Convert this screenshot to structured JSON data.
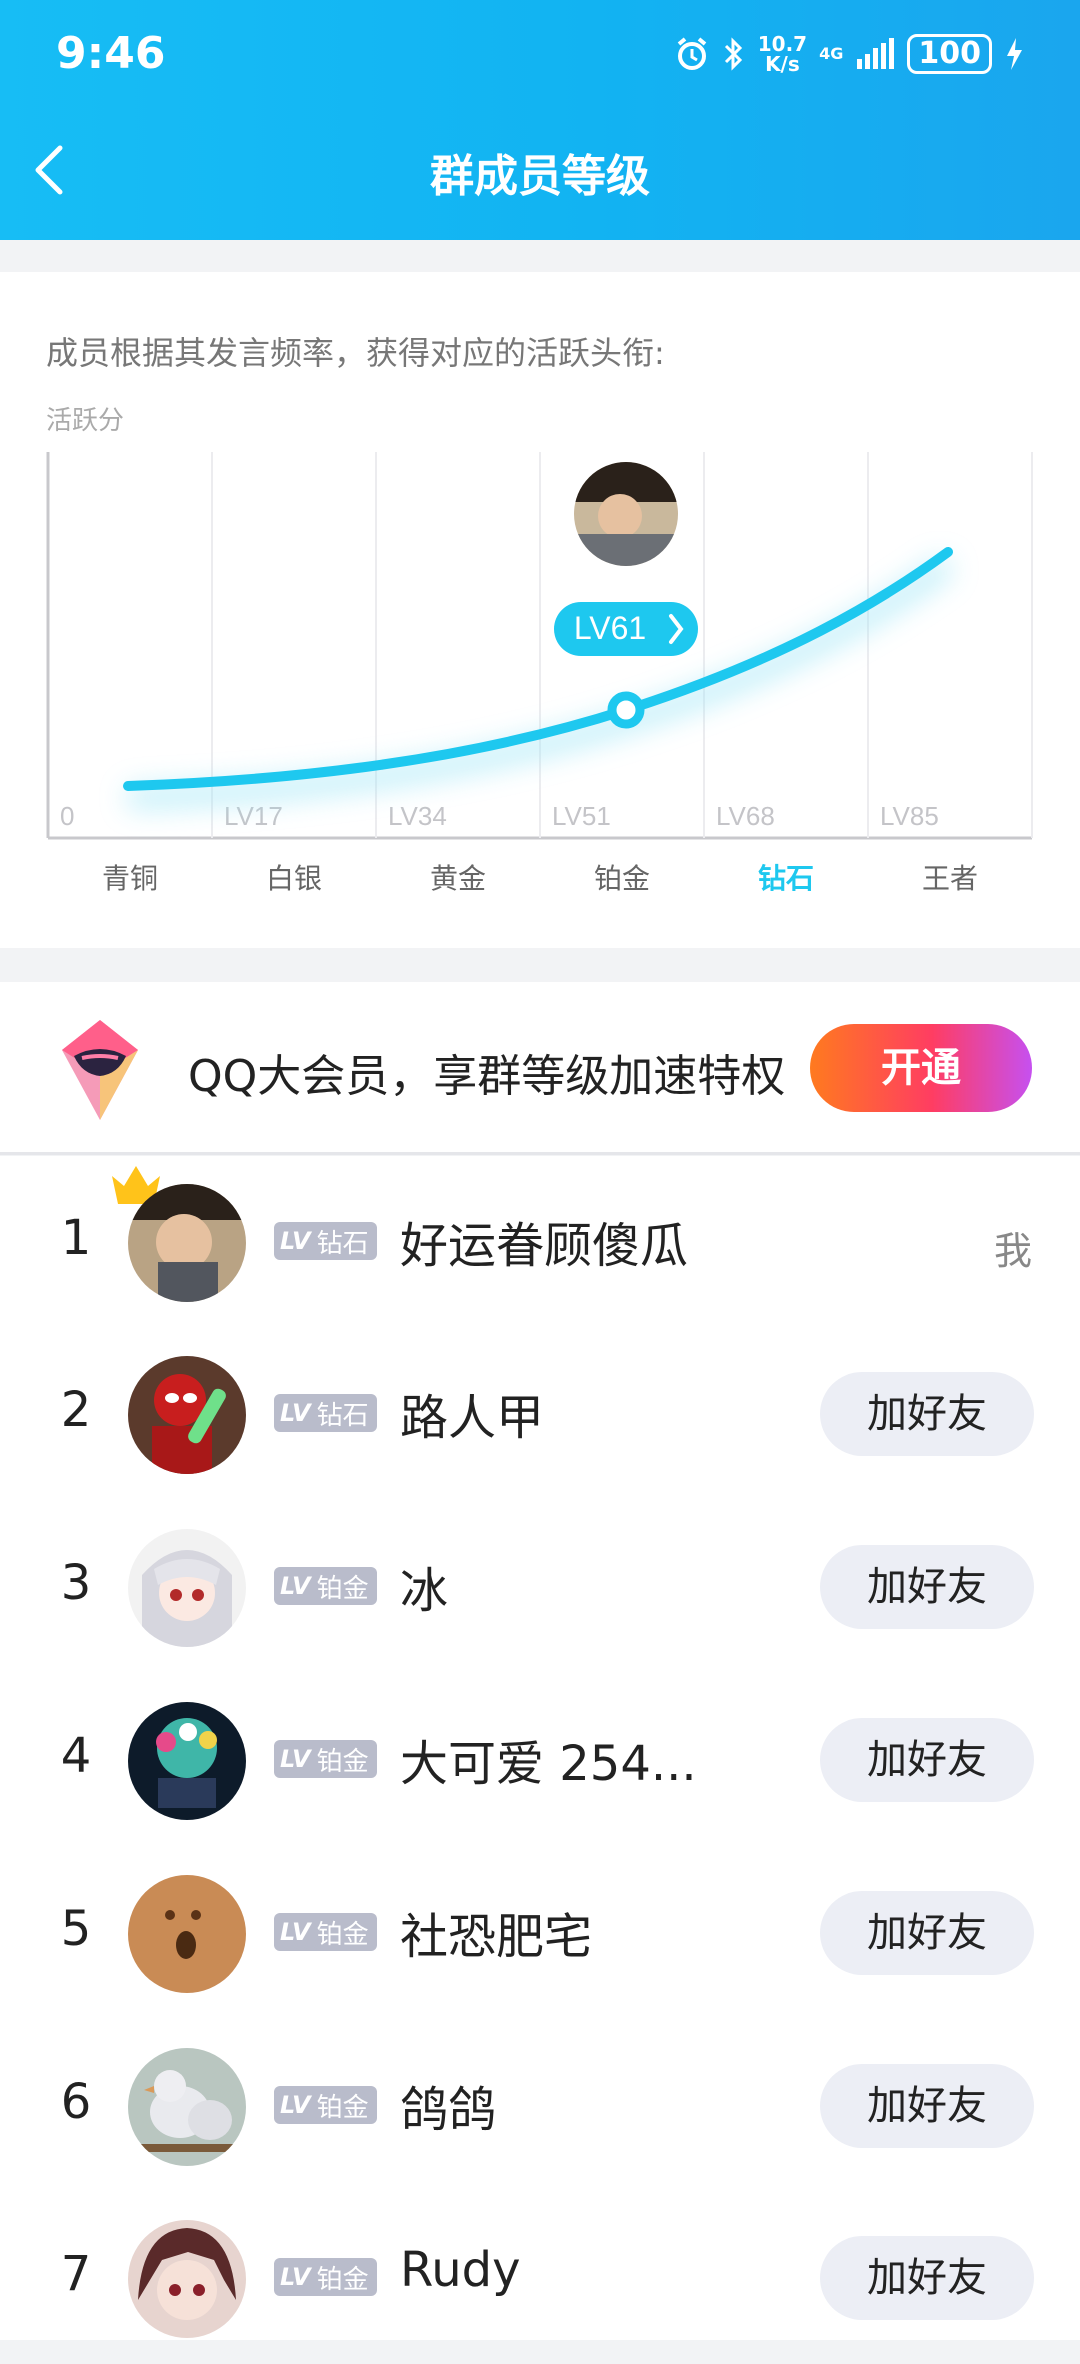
{
  "status_bar": {
    "time": "9:46",
    "net_speed_top": "10.7",
    "net_speed_bottom": "K/s",
    "net_type": "4G",
    "battery": "100"
  },
  "header": {
    "title": "群成员等级"
  },
  "chart_card": {
    "description": "成员根据其发言频率，获得对应的活跃头衔:",
    "y_axis_label": "活跃分",
    "current_level_label": "LV61",
    "accent_color": "#1ec8ef"
  },
  "chart_data": {
    "type": "line",
    "title": "",
    "xlabel": "",
    "ylabel": "活跃分",
    "categories": [
      "青铜",
      "白银",
      "黄金",
      "铂金",
      "钻石",
      "王者"
    ],
    "highlighted_category": "钻石",
    "level_thresholds": [
      "0",
      "LV17",
      "LV34",
      "LV51",
      "LV68",
      "LV85"
    ],
    "marker": {
      "label": "LV61",
      "level": 61
    },
    "grid": true
  },
  "vip": {
    "text": "QQ大会员，享群等级加速特权",
    "button_label": "开通"
  },
  "members": [
    {
      "rank": "1",
      "badge_lv": "LV",
      "badge_title": "钻石",
      "name": "好运眷顾傻瓜",
      "action": "我",
      "is_me": true
    },
    {
      "rank": "2",
      "badge_lv": "LV",
      "badge_title": "钻石",
      "name": "路人甲",
      "action": "加好友",
      "is_me": false
    },
    {
      "rank": "3",
      "badge_lv": "LV",
      "badge_title": "铂金",
      "name": "冰",
      "action": "加好友",
      "is_me": false
    },
    {
      "rank": "4",
      "badge_lv": "LV",
      "badge_title": "铂金",
      "name": "大可爱 254...",
      "action": "加好友",
      "is_me": false
    },
    {
      "rank": "5",
      "badge_lv": "LV",
      "badge_title": "铂金",
      "name": "社恐肥宅",
      "action": "加好友",
      "is_me": false
    },
    {
      "rank": "6",
      "badge_lv": "LV",
      "badge_title": "铂金",
      "name": "鸽鸽",
      "action": "加好友",
      "is_me": false
    },
    {
      "rank": "7",
      "badge_lv": "LV",
      "badge_title": "铂金",
      "name": "Rudy",
      "action": "加好友",
      "is_me": false
    }
  ]
}
